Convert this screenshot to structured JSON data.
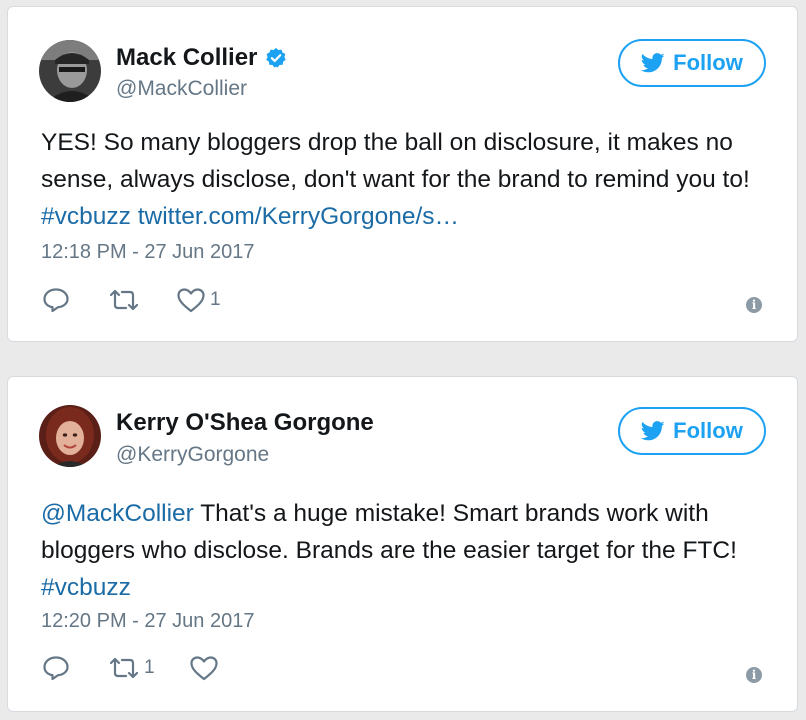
{
  "tweets": [
    {
      "name": "Mack Collier",
      "verified": true,
      "handle": "@MackCollier",
      "follow_label": "Follow",
      "text_plain": "YES! So many bloggers drop the ball on disclosure, it makes no sense, always disclose, don't want for the brand to remind you to! ",
      "hashtag": "#vcbuzz",
      "link": "twitter.com/KerryGorgone/s…",
      "timestamp": "12:18 PM - 27 Jun 2017",
      "reply_count": "",
      "retweet_count": "",
      "like_count": "1",
      "info_glyph": "i"
    },
    {
      "name": "Kerry O'Shea Gorgone",
      "verified": false,
      "handle": "@KerryGorgone",
      "follow_label": "Follow",
      "mention": "@MackCollier",
      "text_plain": " That's a huge mistake! Smart brands work with bloggers who disclose. Brands are the easier target for the FTC! ",
      "hashtag": "#vcbuzz",
      "timestamp": "12:20 PM - 27 Jun 2017",
      "reply_count": "",
      "retweet_count": "1",
      "like_count": "",
      "info_glyph": "i"
    }
  ],
  "colors": {
    "accent": "#1da1f2",
    "link": "#1b6ba6",
    "muted": "#657786",
    "verified": "#1da1f2"
  },
  "icons": [
    "reply-icon",
    "retweet-icon",
    "heart-icon",
    "info-icon",
    "twitter-bird-icon",
    "verified-badge-icon"
  ]
}
